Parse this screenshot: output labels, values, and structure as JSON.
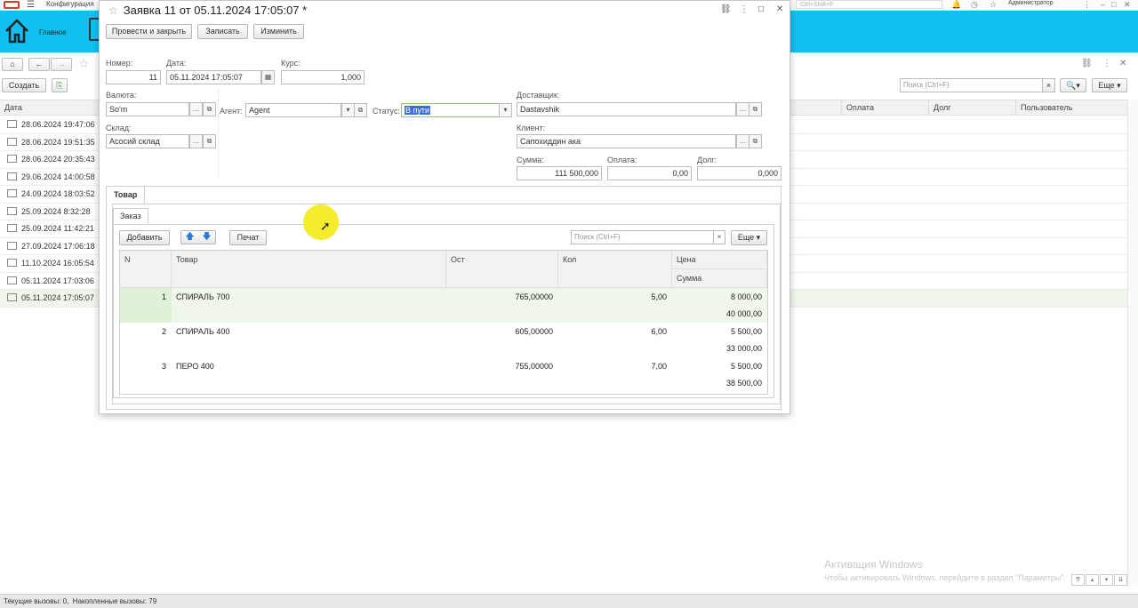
{
  "topbar": {
    "app_title": "Конфигурация",
    "search_hint": "Ctrl+Shift+F",
    "user": "Администратор"
  },
  "sections": {
    "home_label": "Главное"
  },
  "list": {
    "create_label": "Создать",
    "search_placeholder": "Поиск (Ctrl+F)",
    "more_label": "Еще",
    "columns": {
      "date": "Дата",
      "payment": "Оплата",
      "debt": "Долг",
      "user": "Пользователь"
    },
    "rows": [
      "28.06.2024 19:47:06",
      "28.06.2024 19:51:35",
      "28.06.2024 20:35:43",
      "29.06.2024 14:00:58",
      "24.09.2024 18:03:52",
      "25.09.2024 8:32:28",
      "25.09.2024 11:42:21",
      "27.09.2024 17:06:18",
      "11.10.2024 16:05:54",
      "05.11.2024 17:03:06",
      "05.11.2024 17:05:07"
    ]
  },
  "modal": {
    "title": "Заявка 11 от 05.11.2024 17:05:07 *",
    "buttons": {
      "post_close": "Провести и закрыть",
      "save": "Записать",
      "change": "Изминить"
    },
    "fields": {
      "number_label": "Номер:",
      "number_value": "11",
      "date_label": "Дата:",
      "date_value": "05.11.2024 17:05:07",
      "rate_label": "Курс:",
      "rate_value": "1,000",
      "currency_label": "Валюта:",
      "currency_value": "So'm",
      "warehouse_label": "Склад:",
      "warehouse_value": "Асосий склад",
      "agent_label": "Агент:",
      "agent_value": "Agent",
      "status_label": "Статус:",
      "status_value": "В пути",
      "supplier_label": "Доставщик:",
      "supplier_value": "Dastavshik",
      "client_label": "Клиент:",
      "client_value": "Сапохиддин ака",
      "sum_label": "Сумма:",
      "sum_value": "111 500,000",
      "paid_label": "Оплата:",
      "paid_value": "0,00",
      "debt_label": "Долг:",
      "debt_value": "0,000"
    },
    "tabs": {
      "goods": "Товар",
      "order": "Заказ"
    },
    "table_toolbar": {
      "add": "Добавить",
      "print": "Печат",
      "search_placeholder": "Поиск (Ctrl+F)",
      "more": "Еще"
    },
    "table": {
      "headers": {
        "n": "N",
        "product": "Товар",
        "stock": "Ост",
        "qty": "Кол",
        "price": "Цена",
        "sum": "Сумма"
      },
      "rows": [
        {
          "n": "1",
          "product": "СПИРАЛЬ  700",
          "stock": "765,00000",
          "qty": "5,00",
          "price": "8 000,00",
          "sum": "40 000,00"
        },
        {
          "n": "2",
          "product": "СПИРАЛЬ  400",
          "stock": "605,00000",
          "qty": "6,00",
          "price": "5 500,00",
          "sum": "33 000,00"
        },
        {
          "n": "3",
          "product": "ПЕРО  400",
          "stock": "755,00000",
          "qty": "7,00",
          "price": "5 500,00",
          "sum": "38 500,00"
        }
      ]
    }
  },
  "watermark": {
    "title": "Активация Windows",
    "subtitle": "Чтобы активировать Windows, перейдите в раздел \"Параметры\"."
  },
  "statusbar": {
    "current_calls": "Текущие вызовы: 0",
    "accumulated_calls": "Накопленные вызовы: 79"
  },
  "colors": {
    "sections_bar": "#11c0f0",
    "selection_row": "#eef7ea",
    "status_highlight": "#3a6fd8",
    "cursor_highlight": "#f4ea1a"
  }
}
